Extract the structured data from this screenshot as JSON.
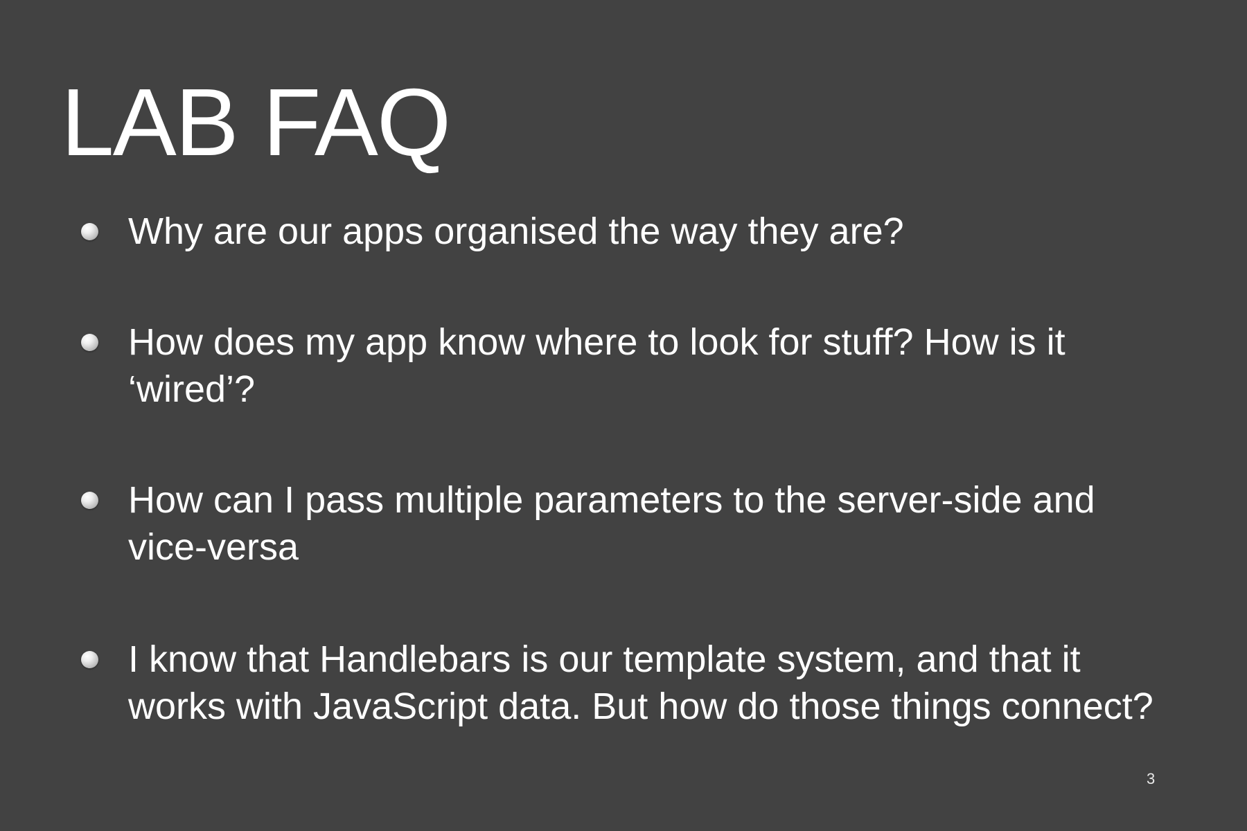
{
  "slide": {
    "title": "LAB FAQ",
    "bullets": [
      {
        "text": "Why are our apps organised the way they are?"
      },
      {
        "text": "How does my app know where to look for stuff? How is it ‘wired’?"
      },
      {
        "text": "How can I pass multiple parameters to the server-side and vice-versa"
      },
      {
        "text": "I know that Handlebars is our template system, and that it works with JavaScript data. But how do those things connect?"
      }
    ],
    "page_number": "3"
  },
  "colors": {
    "background": "#424242",
    "text": "#ffffff"
  }
}
